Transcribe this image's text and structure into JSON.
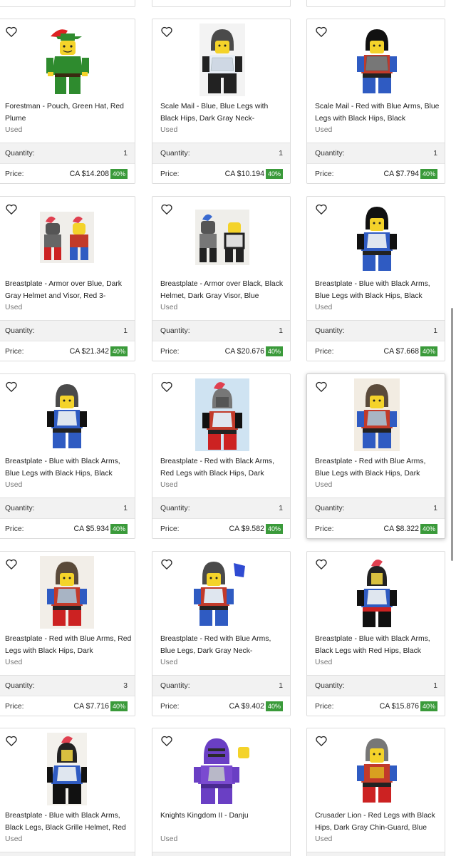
{
  "labels": {
    "quantity": "Quantity:",
    "price": "Price:"
  },
  "colors": {
    "badge": "#3a9a3a",
    "row_bg": "#f2f2f2"
  },
  "cards": [
    {
      "title": "Forestman - Pouch, Green Hat, Red Plume",
      "condition": "Used",
      "quantity": "1",
      "price": "CA $14.208",
      "discount": "40%",
      "icon": "forestman-minifig"
    },
    {
      "title": "Scale Mail - Blue, Blue Legs with Black Hips, Dark Gray Neck-",
      "condition": "Used",
      "quantity": "1",
      "price": "CA $10.194",
      "discount": "40%",
      "icon": "scale-mail-minifig"
    },
    {
      "title": "Scale Mail - Red with Blue Arms, Blue Legs with Black Hips, Black",
      "condition": "Used",
      "quantity": "1",
      "price": "CA $7.794",
      "discount": "40%",
      "icon": "scale-mail-minifig"
    },
    {
      "title": "Breastplate - Armor over Blue, Dark Gray Helmet and Visor, Red 3-",
      "condition": "Used",
      "quantity": "1",
      "price": "CA $21.342",
      "discount": "40%",
      "icon": "breastplate-minifig"
    },
    {
      "title": "Breastplate - Armor over Black, Black Helmet, Dark Gray Visor, Blue",
      "condition": "Used",
      "quantity": "1",
      "price": "CA $20.676",
      "discount": "40%",
      "icon": "breastplate-minifig"
    },
    {
      "title": "Breastplate - Blue with Black Arms, Blue Legs with Black Hips, Black",
      "condition": "Used",
      "quantity": "1",
      "price": "CA $7.668",
      "discount": "40%",
      "icon": "breastplate-minifig"
    },
    {
      "title": "Breastplate - Blue with Black Arms, Blue Legs with Black Hips, Black",
      "condition": "Used",
      "quantity": "1",
      "price": "CA $5.934",
      "discount": "40%",
      "icon": "breastplate-minifig"
    },
    {
      "title": "Breastplate - Red with Black Arms, Red Legs with Black Hips, Dark",
      "condition": "Used",
      "quantity": "1",
      "price": "CA $9.582",
      "discount": "40%",
      "icon": "breastplate-minifig"
    },
    {
      "title": "Breastplate - Red with Blue Arms, Blue Legs with Black Hips, Dark",
      "condition": "Used",
      "quantity": "1",
      "price": "CA $8.322",
      "discount": "40%",
      "icon": "breastplate-minifig"
    },
    {
      "title": "Breastplate - Red with Blue Arms, Red Legs with Black Hips, Dark",
      "condition": "Used",
      "quantity": "3",
      "price": "CA $7.716",
      "discount": "40%",
      "icon": "breastplate-minifig"
    },
    {
      "title": "Breastplate - Red with Blue Arms, Blue Legs, Dark Gray Neck-",
      "condition": "Used",
      "quantity": "1",
      "price": "CA $9.402",
      "discount": "40%",
      "icon": "breastplate-minifig"
    },
    {
      "title": "Breastplate - Blue with Black Arms, Black Legs with Red Hips, Black",
      "condition": "Used",
      "quantity": "1",
      "price": "CA $15.876",
      "discount": "40%",
      "icon": "breastplate-minifig"
    },
    {
      "title": "Breastplate - Blue with Black Arms, Black Legs, Black Grille Helmet, Red",
      "condition": "Used",
      "quantity": "",
      "price": "",
      "discount": "",
      "icon": "breastplate-minifig"
    },
    {
      "title": "Knights Kingdom II - Danju",
      "condition": "Used",
      "quantity": "",
      "price": "",
      "discount": "",
      "icon": "knight-minifig"
    },
    {
      "title": "Crusader Lion - Red Legs with Black Hips, Dark Gray Chin-Guard, Blue",
      "condition": "Used",
      "quantity": "",
      "price": "",
      "discount": "",
      "icon": "crusader-minifig"
    }
  ]
}
